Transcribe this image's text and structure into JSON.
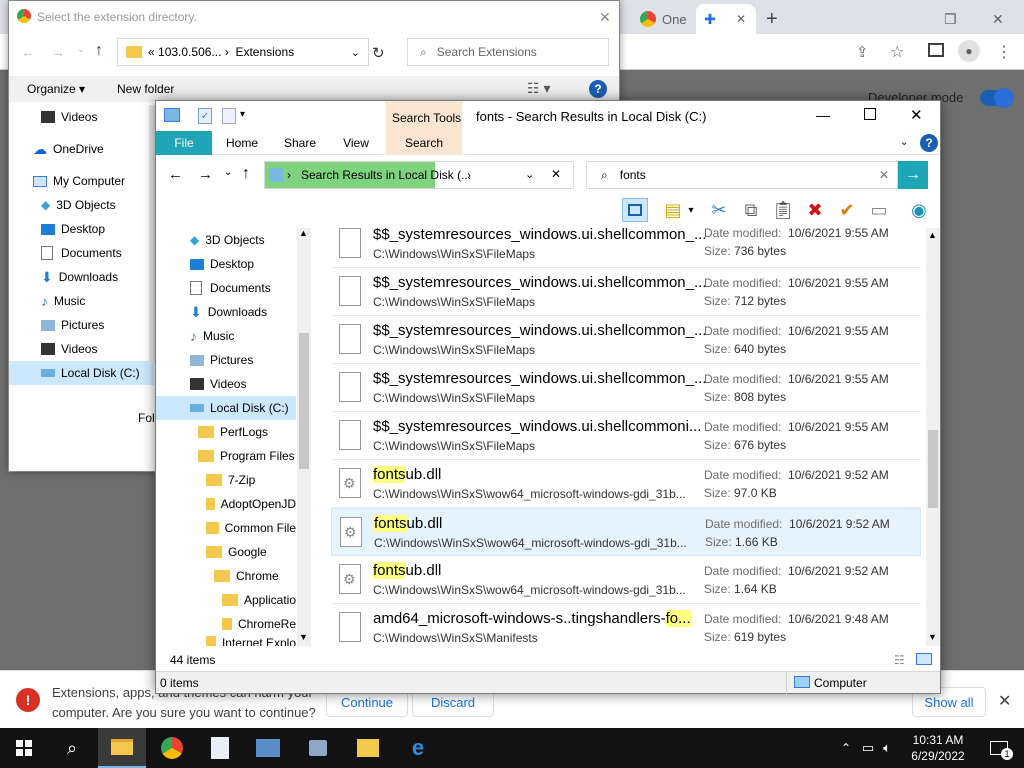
{
  "chrome": {
    "tab1_label": "One",
    "new_tab_symbol": "+",
    "developer_mode_label": "Developer mode",
    "warning_text_line1": "Extensions, apps, and themes can harm your",
    "warning_text_line2": "computer. Are you sure you want to continue?",
    "continue_label": "Continue",
    "discard_label": "Discard",
    "show_all_label": "Show all"
  },
  "select_dialog": {
    "title": "Select the extension directory.",
    "address_parts": [
      "«",
      "103.0.506...",
      "›",
      "Extensions"
    ],
    "search_placeholder": "Search Extensions",
    "organize_label": "Organize ▾",
    "new_folder_label": "New folder",
    "nav_items": [
      "Videos",
      "OneDrive",
      "My Computer",
      "3D Objects",
      "Desktop",
      "Documents",
      "Downloads",
      "Music",
      "Pictures",
      "Videos",
      "Local Disk (C:)"
    ],
    "folder_label_partial": "Fol"
  },
  "explorer": {
    "title": "fonts - Search Results in Local Disk (C:)",
    "search_tools_label": "Search Tools",
    "ribbon_tabs": [
      "File",
      "Home",
      "Share",
      "View",
      "Search"
    ],
    "address_text": "Search Results in Local Disk (...",
    "search_value": "fonts",
    "nav_items": [
      "3D Objects",
      "Desktop",
      "Documents",
      "Downloads",
      "Music",
      "Pictures",
      "Videos",
      "Local Disk (C:)",
      "PerfLogs",
      "Program Files",
      "7-Zip",
      "AdoptOpenJD",
      "Common File",
      "Google",
      "Chrome",
      "Applicatio",
      "ChromeRe",
      "Internet Explo"
    ],
    "date_label": "Date modified:",
    "size_label": "Size:",
    "results": [
      {
        "pre": "$$_systemresources_windows.ui.shellcommon_...",
        "hl": "",
        "post": "",
        "path": "C:\\Windows\\WinSxS\\FileMaps",
        "date": "10/6/2021 9:55 AM",
        "size": "736 bytes"
      },
      {
        "pre": "$$_systemresources_windows.ui.shellcommon_...",
        "hl": "",
        "post": "",
        "path": "C:\\Windows\\WinSxS\\FileMaps",
        "date": "10/6/2021 9:55 AM",
        "size": "712 bytes"
      },
      {
        "pre": "$$_systemresources_windows.ui.shellcommon_...",
        "hl": "",
        "post": "",
        "path": "C:\\Windows\\WinSxS\\FileMaps",
        "date": "10/6/2021 9:55 AM",
        "size": "640 bytes"
      },
      {
        "pre": "$$_systemresources_windows.ui.shellcommon_...",
        "hl": "",
        "post": "",
        "path": "C:\\Windows\\WinSxS\\FileMaps",
        "date": "10/6/2021 9:55 AM",
        "size": "808 bytes"
      },
      {
        "pre": "$$_systemresources_windows.ui.shellcommoni...",
        "hl": "",
        "post": "",
        "path": "C:\\Windows\\WinSxS\\FileMaps",
        "date": "10/6/2021 9:55 AM",
        "size": "676 bytes"
      },
      {
        "pre": "",
        "hl": "fonts",
        "post": "ub.dll",
        "path": "C:\\Windows\\WinSxS\\wow64_microsoft-windows-gdi_31b...",
        "date": "10/6/2021 9:52 AM",
        "size": "97.0 KB"
      },
      {
        "pre": "",
        "hl": "fonts",
        "post": "ub.dll",
        "path": "C:\\Windows\\WinSxS\\wow64_microsoft-windows-gdi_31b...",
        "date": "10/6/2021 9:52 AM",
        "size": "1.66 KB"
      },
      {
        "pre": "",
        "hl": "fonts",
        "post": "ub.dll",
        "path": "C:\\Windows\\WinSxS\\wow64_microsoft-windows-gdi_31b...",
        "date": "10/6/2021 9:52 AM",
        "size": "1.64 KB"
      },
      {
        "pre": "amd64_microsoft-windows-s..tingshandlers-",
        "hl": "fo...",
        "post": "",
        "path": "C:\\Windows\\WinSxS\\Manifests",
        "date": "10/6/2021 9:48 AM",
        "size": "619 bytes"
      }
    ],
    "item_count": "44 items",
    "selected_count": "0 items",
    "location_label": "Computer"
  },
  "taskbar": {
    "time": "10:31 AM",
    "date": "6/29/2022",
    "notification_count": "1"
  }
}
